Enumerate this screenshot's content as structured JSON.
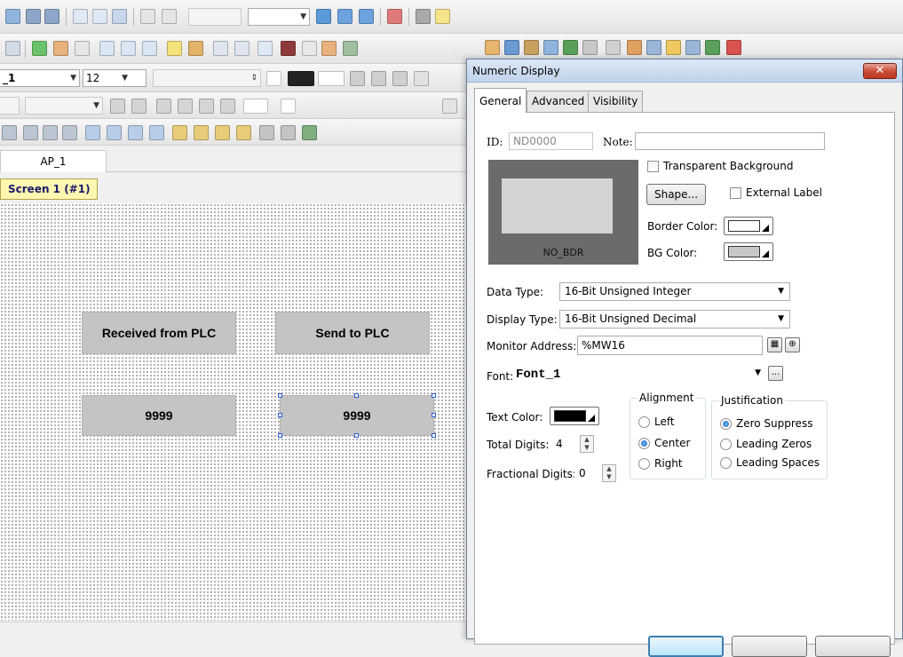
{
  "toolbar": {
    "font_name": "_1",
    "font_size": "12"
  },
  "editor": {
    "doc_tab": "AP_1",
    "screen_tab": "Screen 1 (#1)",
    "objects": {
      "received_label": "Received from PLC",
      "send_label": "Send to PLC",
      "received_value": "9999",
      "send_value": "9999"
    }
  },
  "dialog": {
    "title": "Numeric Display",
    "close_symbol": "✕",
    "tabs": [
      "General",
      "Advanced",
      "Visibility"
    ],
    "id_label": "ID:",
    "id_value": "ND0000",
    "note_label": "Note:",
    "note_value": "",
    "preview_caption": "NO_BDR",
    "transparent_bg_label": "Transparent Background",
    "shape_button": "Shape...",
    "external_label_label": "External Label",
    "border_color_label": "Border Color:",
    "bg_color_label": "BG Color:",
    "data_type_label": "Data Type:",
    "data_type_value": "16-Bit Unsigned Integer",
    "display_type_label": "Display Type:",
    "display_type_value": "16-Bit Unsigned Decimal",
    "monitor_address_label": "Monitor Address:",
    "monitor_address_value": "%MW16",
    "font_label": "Font:",
    "font_value": "Font_1",
    "font_more": "...",
    "text_color_label": "Text Color:",
    "total_digits_label": "Total Digits:",
    "total_digits_value": "4",
    "fractional_digits_label": "Fractional Digits:",
    "fractional_digits_value": "0",
    "alignment": {
      "title": "Alignment",
      "options": [
        "Left",
        "Center",
        "Right"
      ],
      "selected": "Center"
    },
    "justification": {
      "title": "Justification",
      "options": [
        "Zero Suppress",
        "Leading Zeros",
        "Leading Spaces"
      ],
      "selected": "Zero Suppress"
    },
    "colors": {
      "border": "#ffffff",
      "bg": "#c8c8c8",
      "text": "#000000",
      "preview_outer": "#6b6b6b",
      "preview_inner": "#d3d3d3"
    }
  }
}
